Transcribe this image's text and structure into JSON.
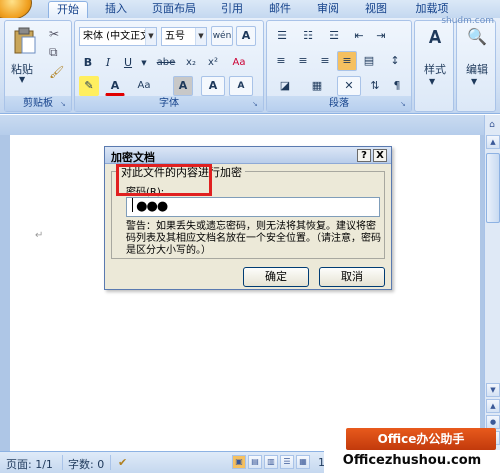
{
  "tabs": [
    {
      "label": "开始",
      "active": true
    },
    {
      "label": "插入",
      "active": false
    },
    {
      "label": "页面布局",
      "active": false
    },
    {
      "label": "引用",
      "active": false
    },
    {
      "label": "邮件",
      "active": false
    },
    {
      "label": "审阅",
      "active": false
    },
    {
      "label": "视图",
      "active": false
    },
    {
      "label": "加载项",
      "active": false
    }
  ],
  "watermark_top": "shudm.com",
  "ribbon": {
    "clipboard": {
      "label": "剪贴板",
      "paste": "粘贴"
    },
    "font": {
      "label": "字体",
      "font_name": "宋体 (中文正文)",
      "font_size": "五号",
      "phonetic": "wén",
      "border_char": "A",
      "bold": "B",
      "italic": "I",
      "underline": "U",
      "strike": "abe",
      "subscript": "x₂",
      "superscript": "x²",
      "clear_format": "Aa",
      "grow_font": "A",
      "shrink_font": "A",
      "font_color": "A",
      "shading": "A",
      "change_case": "Aa"
    },
    "paragraph": {
      "label": "段落"
    },
    "styles": {
      "label": "样式"
    },
    "editing": {
      "label": "编辑"
    }
  },
  "dialog": {
    "title": "加密文档",
    "help_btn": "?",
    "close_btn": "X",
    "group_title": "对此文件的内容进行加密",
    "password_label": "密码(R):",
    "password_value": "●●●",
    "warning_text": "警告：如果丢失或遗忘密码，则无法将其恢复。建议将密码列表及其相应文档名放在一个安全位置。（请注意，密码是区分大小写的。）",
    "ok": "确定",
    "cancel": "取消"
  },
  "statusbar": {
    "page": "页面: 1/1",
    "words": "字数: 0",
    "zoom": "100%"
  },
  "branding": {
    "title": "Office办公助手",
    "url": "Officezhushou.com"
  },
  "colors": {
    "ribbon_bg": "#d2e1f4",
    "doc_bg": "#aec6e6",
    "highlight": "#e02020",
    "brand": "#e85a1c"
  }
}
